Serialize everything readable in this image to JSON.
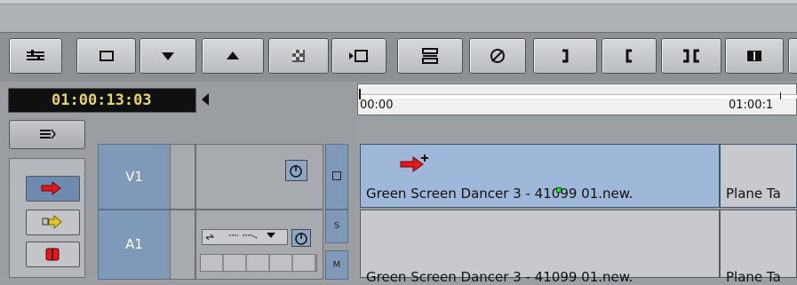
{
  "toolbar": {
    "buttons": [
      "adjust-icon",
      "folder-icon",
      "arrow-down-icon",
      "arrow-up-icon",
      "checkerboard-icon",
      "play-into-frame-icon",
      "split-icon",
      "no-icon",
      "mark-out-icon",
      "mark-in-icon",
      "mark-clip-icon",
      "segment-icon",
      "extra-icon"
    ]
  },
  "timecode": "01:00:13:03",
  "ruler": {
    "start": "00:00",
    "end": "01:00:1"
  },
  "tracks": {
    "v1": {
      "label": "V1",
      "indicator": ""
    },
    "a1": {
      "label": "A1",
      "indicator_s": "S",
      "indicator_m": "M"
    }
  },
  "clips": {
    "v1_clip_name": "Green Screen Dancer 3 - 41099 01.new.",
    "v1_clip_next": "Plane Ta",
    "a1_clip_name": "Green Screen Dancer 3 - 41099 01.new.",
    "a1_clip_next": "Plane Ta"
  },
  "colors": {
    "accent_green": "#e6d56a",
    "clip_video": "#9fb7d8",
    "track_blue": "#7f99b8",
    "marker_red": "#e01a1a"
  }
}
